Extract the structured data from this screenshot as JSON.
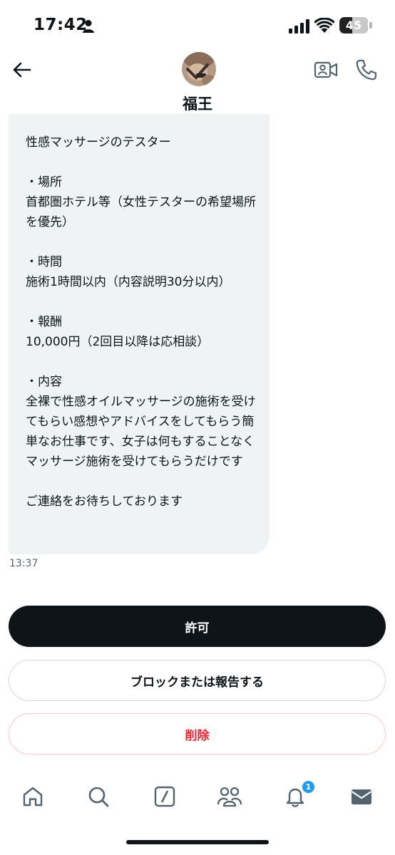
{
  "status_bar": {
    "time": "17:42",
    "battery": "45",
    "battery_level": 0.45
  },
  "header": {
    "contact_name": "福王",
    "avatar": "avatar-photo",
    "back_icon": "arrow-left-icon",
    "video_icon": "video-camera-icon",
    "phone_icon": "phone-icon"
  },
  "message": {
    "text": "性感マッサージのテスター\n\n・場所\n首都圏ホテル等（女性テスターの希望場所を優先）\n\n・時間\n施術1時間以内（内容説明30分以内）\n\n・報酬\n10,000円（2回目以降は応相談）\n\n・内容\n全裸で性感オイルマッサージの施術を受けてもらい感想やアドバイスをしてもらう簡単なお仕事です、女子は何もすることなくマッサージ施術を受けてもらうだけです\n\nご連絡をお待ちしております",
    "time": "13:37"
  },
  "actions": {
    "allow_label": "許可",
    "block_label": "ブロックまたは報告する",
    "delete_label": "削除"
  },
  "bottom_nav": {
    "items": [
      "home-icon",
      "search-icon",
      "compose-icon",
      "communities-icon",
      "notifications-icon",
      "messages-icon"
    ],
    "notification_badge": "1"
  },
  "colors": {
    "primary_dark": "#0f1419",
    "bubble_bg": "#eff3f4",
    "danger": "#f4212e",
    "badge": "#1d9bf0",
    "icon_gray": "#536471"
  }
}
